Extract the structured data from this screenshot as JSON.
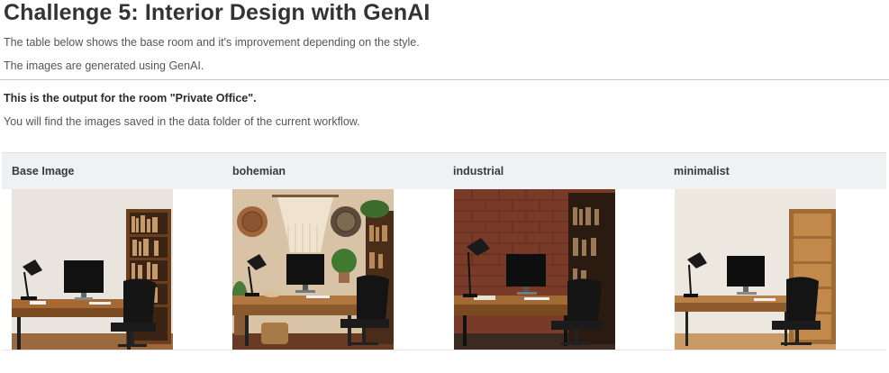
{
  "heading": "Challenge 5: Interior Design with GenAI",
  "intro_line_1": "The table below shows the base room and it's improvement depending on the style.",
  "intro_line_2": "The images are generated using GenAI.",
  "output_title": "This is the output for the room \"Private Office\".",
  "output_note": "You will find the images saved in the data folder of the current workflow.",
  "table": {
    "columns": [
      "Base Image",
      "bohemian",
      "industrial",
      "minimalist"
    ]
  }
}
